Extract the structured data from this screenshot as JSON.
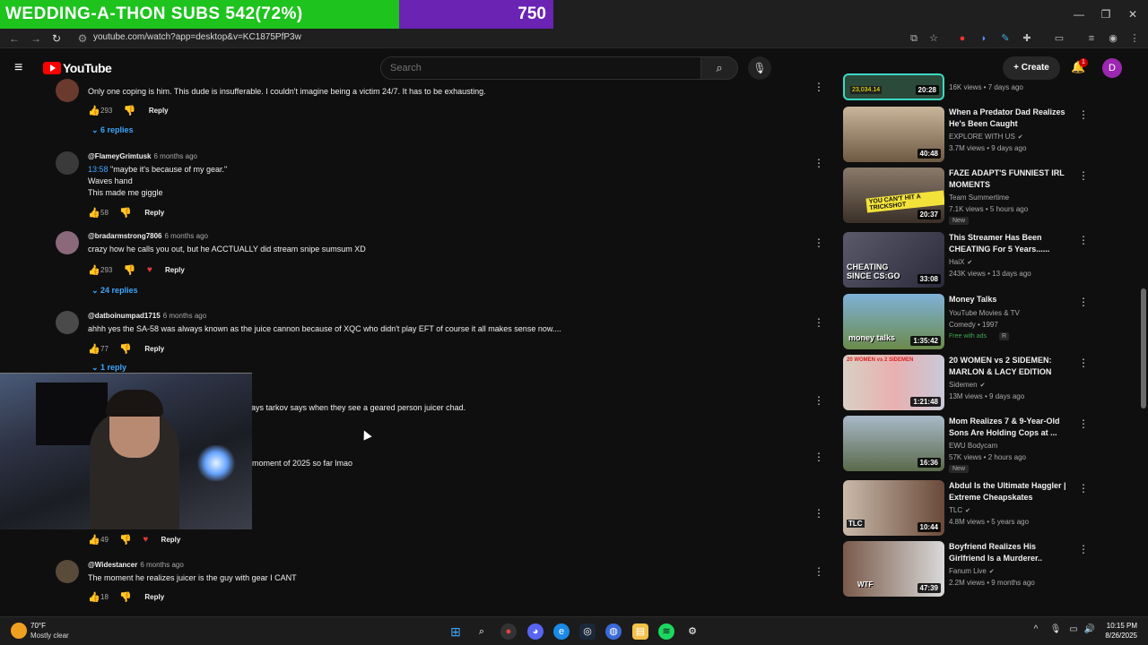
{
  "overlay": {
    "subs_label": "WEDDING-A-THON SUBS 542(72%)",
    "counter": "750"
  },
  "browser": {
    "url": "youtube.com/watch?app=desktop&v=KC1875PfP3w",
    "minimize": "—",
    "restore": "❐",
    "close": "✕"
  },
  "header": {
    "logo_text": "YouTube",
    "search_placeholder": "Search",
    "create_label": "Create",
    "notif_count": "1",
    "avatar_letter": "D"
  },
  "comments": [
    {
      "text": "Only one coping is him. This dude is insufferable. I couldn't imagine being a victim 24/7. It has to be exhausting.",
      "likes": "293",
      "reply": "Reply",
      "replies": "6 replies"
    },
    {
      "user": "@FlameyGrimtusk",
      "time": "6 months ago",
      "timestamp": "13:58",
      "line1": "\"maybe it's because of my gear.\"",
      "line2": "Waves hand",
      "line3": "This made me giggle",
      "likes": "58",
      "reply": "Reply"
    },
    {
      "user": "@bradarmstrong7806",
      "time": "6 months ago",
      "text": "crazy how he calls you out, but he ACCTUALLY did stream snipe sumsum XD",
      "likes": "293",
      "reply": "Reply",
      "replies": "24 replies"
    },
    {
      "user": "@datboinumpad1715",
      "time": "6 months ago",
      "text": "ahhh yes the SA-58 was always known as the juice cannon because of XQC who didn't play EFT of course it all makes sense now....",
      "likes": "77",
      "reply": "Reply",
      "replies": "1 reply"
    },
    {
      "text": "ays tarkov says when they see a geared person juicer chad."
    },
    {
      "text": "moment of 2025 so far lmao",
      "likes": "49",
      "reply": "Reply"
    },
    {
      "user": "@Widestancer",
      "time": "6 months ago",
      "text": "The moment he realizes juicer is the guy with gear I CANT",
      "likes": "18",
      "reply": "Reply"
    }
  ],
  "videos": [
    {
      "title": "",
      "channel": "",
      "meta": "16K views • 7 days ago",
      "duration": "20:28",
      "badge": "23,034.14"
    },
    {
      "title": "When a Predator Dad Realizes He's Been Caught",
      "channel": "EXPLORE WITH US",
      "meta": "3.7M views • 9 days ago",
      "duration": "40:48"
    },
    {
      "title": "FAZE ADAPT'S FUNNIEST IRL MOMENTS",
      "channel": "Team Summertime",
      "meta": "7.1K views • 5 hours ago",
      "duration": "20:37",
      "new": "New",
      "thumb_text": "YOU CAN'T HIT A TRICKSHOT"
    },
    {
      "title": "This Streamer Has Been CHEATING For 5 Years......",
      "channel": "HaiX",
      "meta": "243K views • 13 days ago",
      "duration": "33:08",
      "thumb_text": "CHEATING SINCE CS:GO"
    },
    {
      "title": "Money Talks",
      "channel": "YouTube Movies & TV",
      "meta": "Comedy • 1997",
      "duration": "1:35:42",
      "free": "Free with ads",
      "rating": "R",
      "thumb_text": "money talks"
    },
    {
      "title": "20 WOMEN vs 2 SIDEMEN: MARLON & LACY EDITION",
      "channel": "Sidemen",
      "meta": "13M views • 9 days ago",
      "duration": "1:21:48",
      "thumb_text": "20 WOMEN vs 2 SIDEMEN"
    },
    {
      "title": "Mom Realizes 7 & 9-Year-Old Sons Are Holding Cops at ...",
      "channel": "EWU Bodycam",
      "meta": "57K views • 2 hours ago",
      "duration": "16:36",
      "new": "New"
    },
    {
      "title": "Abdul Is the Ultimate Haggler | Extreme Cheapskates",
      "channel": "TLC",
      "meta": "4.8M views • 5 years ago",
      "duration": "10:44",
      "thumb_text": "TLC"
    },
    {
      "title": "Boyfriend Realizes His Girlfriend Is a Murderer..",
      "channel": "Fanum Live",
      "meta": "2.2M views • 9 months ago",
      "duration": "47:39",
      "thumb_text": "WTF"
    }
  ],
  "taskbar": {
    "temp": "70°F",
    "condition": "Mostly clear",
    "time": "10:15 PM",
    "date": "8/26/2025"
  },
  "colors": {
    "accent_link": "#3ea6ff",
    "yt_red": "#ff0000",
    "overlay_green": "#1ec31e",
    "overlay_purple": "#6a23b3"
  }
}
